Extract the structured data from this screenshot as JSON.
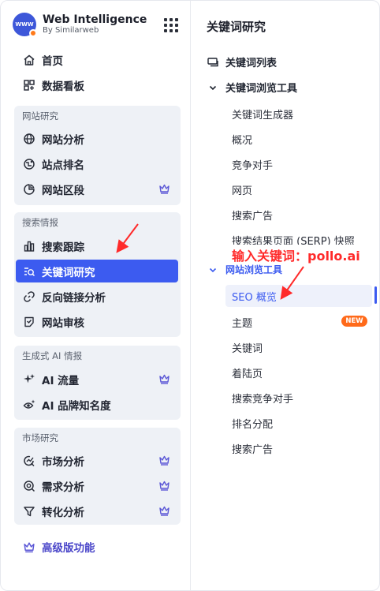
{
  "brand": {
    "title": "Web Intelligence",
    "subtitle": "By Similarweb",
    "logo_text": "WWW"
  },
  "sidebar": {
    "top_items": [
      {
        "label": "首页",
        "icon": "home-icon"
      },
      {
        "label": "数据看板",
        "icon": "dashboard-icon"
      }
    ],
    "groups": [
      {
        "title": "网站研究",
        "items": [
          {
            "label": "网站分析",
            "icon": "globe-icon",
            "premium": false
          },
          {
            "label": "站点排名",
            "icon": "ranking-icon",
            "premium": false
          },
          {
            "label": "网站区段",
            "icon": "segment-icon",
            "premium": true
          }
        ]
      },
      {
        "title": "搜索情报",
        "items": [
          {
            "label": "搜索跟踪",
            "icon": "bar-chart-icon",
            "premium": false
          },
          {
            "label": "关键词研究",
            "icon": "keyword-search-icon",
            "premium": false,
            "active": true
          },
          {
            "label": "反向链接分析",
            "icon": "link-icon",
            "premium": false
          },
          {
            "label": "网站审核",
            "icon": "audit-icon",
            "premium": false
          }
        ]
      },
      {
        "title": "生成式 AI 情报",
        "items": [
          {
            "label": "AI 流量",
            "icon": "sparkle-icon",
            "premium": true
          },
          {
            "label": "AI 品牌知名度",
            "icon": "eye-sparkle-icon",
            "premium": false
          }
        ]
      },
      {
        "title": "市场研究",
        "items": [
          {
            "label": "市场分析",
            "icon": "market-icon",
            "premium": true
          },
          {
            "label": "需求分析",
            "icon": "demand-icon",
            "premium": true
          },
          {
            "label": "转化分析",
            "icon": "funnel-icon",
            "premium": true
          }
        ]
      }
    ],
    "premium_link": "高级版功能"
  },
  "panel": {
    "title": "关键词研究",
    "keyword_list": "关键词列表",
    "keyword_tools": "关键词浏览工具",
    "keyword_tool_items": [
      "关键词生成器",
      "概况",
      "竞争对手",
      "网页",
      "搜索广告",
      "搜索结果页面 (SERP) 快照"
    ],
    "site_tools": "网站浏览工具",
    "site_tool_items": [
      "SEO 概览",
      "主题",
      "关键词",
      "着陆页",
      "搜索竞争对手",
      "排名分配",
      "搜索广告"
    ],
    "new_badge": "NEW"
  },
  "annotation": "输入关键词：pollo.ai",
  "colors": {
    "accent": "#3c5bf0",
    "badge": "#ff6a1a",
    "annotation": "#ff2a2a",
    "group_bg": "#eef1f6",
    "crown": "#5b57d6"
  }
}
